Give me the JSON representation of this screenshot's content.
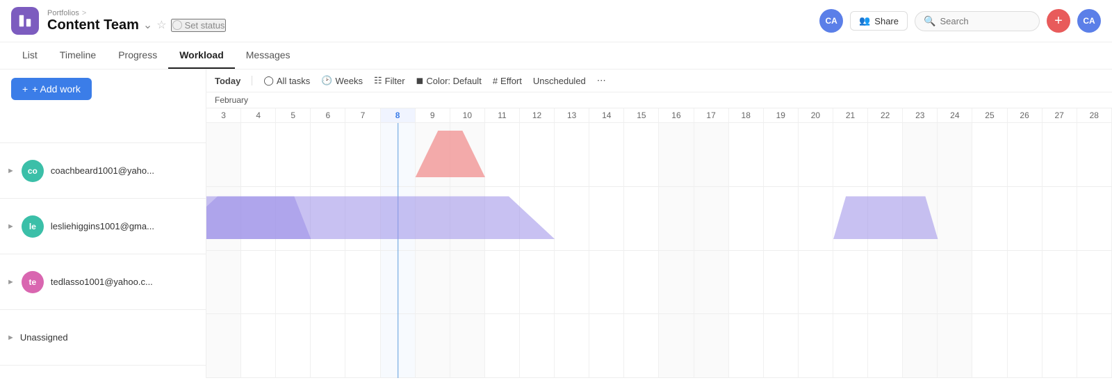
{
  "header": {
    "breadcrumb": "Portfolios",
    "breadcrumb_sep": ">",
    "title": "Content Team",
    "set_status": "Set status",
    "share_label": "Share",
    "search_placeholder": "Search",
    "avatar_initials": "CA"
  },
  "nav": {
    "tabs": [
      {
        "label": "List",
        "active": false
      },
      {
        "label": "Timeline",
        "active": false
      },
      {
        "label": "Progress",
        "active": false
      },
      {
        "label": "Workload",
        "active": true
      },
      {
        "label": "Messages",
        "active": false
      }
    ]
  },
  "toolbar": {
    "add_work": "+ Add work",
    "today": "Today",
    "all_tasks": "All tasks",
    "weeks": "Weeks",
    "filter": "Filter",
    "color": "Color: Default",
    "effort": "Effort",
    "unscheduled": "Unscheduled",
    "more": "..."
  },
  "gantt": {
    "month": "February",
    "days": [
      3,
      4,
      5,
      6,
      7,
      8,
      9,
      10,
      11,
      12,
      13,
      14,
      15,
      16,
      17,
      18,
      19,
      20,
      21,
      22,
      23,
      24,
      25,
      26,
      27,
      28
    ],
    "today_day": 8
  },
  "users": [
    {
      "id": "co",
      "name": "coachbeard1001@yaho...",
      "color": "#3bbfa8",
      "initials": "co"
    },
    {
      "id": "le",
      "name": "lesliehiggins1001@gma...",
      "color": "#3bbfa8",
      "initials": "le"
    },
    {
      "id": "te",
      "name": "tedlasso1001@yahoo.c...",
      "color": "#d966b0",
      "initials": "te"
    },
    {
      "id": "un",
      "name": "Unassigned",
      "color": null,
      "initials": null
    }
  ]
}
